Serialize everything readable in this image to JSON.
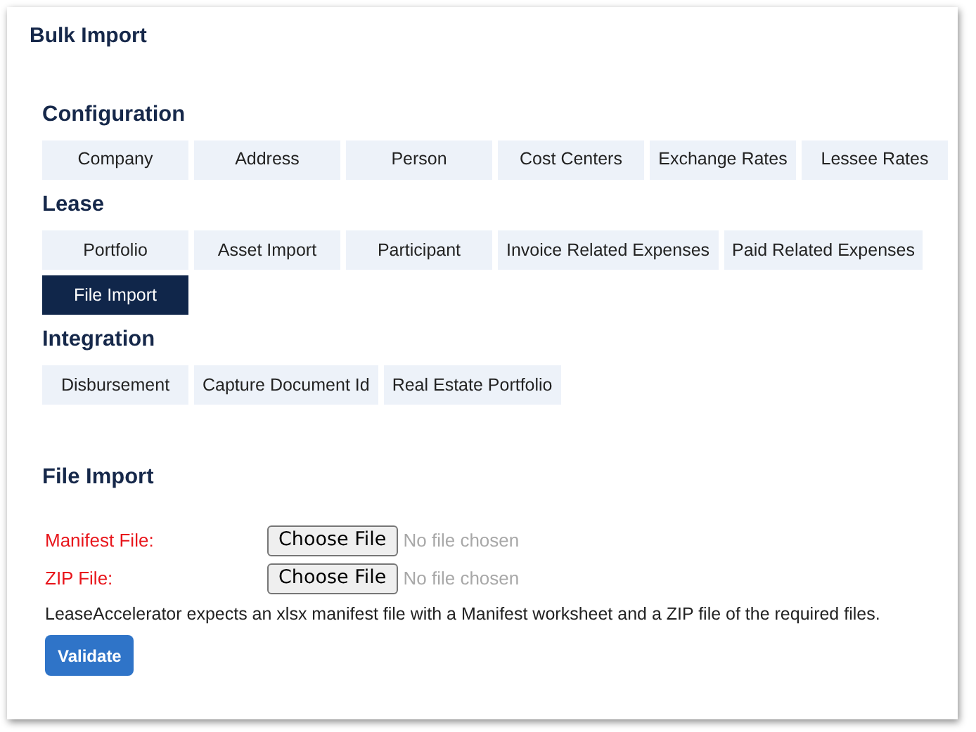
{
  "page": {
    "title": "Bulk Import"
  },
  "sections": [
    {
      "title": "Configuration",
      "tabs": [
        {
          "label": "Company",
          "selected": false
        },
        {
          "label": "Address",
          "selected": false
        },
        {
          "label": "Person",
          "selected": false
        },
        {
          "label": "Cost Centers",
          "selected": false
        },
        {
          "label": "Exchange Rates",
          "selected": false
        },
        {
          "label": "Lessee Rates",
          "selected": false
        }
      ]
    },
    {
      "title": "Lease",
      "tabs": [
        {
          "label": "Portfolio",
          "selected": false
        },
        {
          "label": "Asset Import",
          "selected": false
        },
        {
          "label": "Participant",
          "selected": false
        },
        {
          "label": "Invoice Related Expenses",
          "selected": false
        },
        {
          "label": "Paid Related Expenses",
          "selected": false
        },
        {
          "label": "File Import",
          "selected": true
        }
      ]
    },
    {
      "title": "Integration",
      "tabs": [
        {
          "label": "Disbursement",
          "selected": false
        },
        {
          "label": "Capture Document Id",
          "selected": false
        },
        {
          "label": "Real Estate Portfolio",
          "selected": false
        }
      ]
    }
  ],
  "form": {
    "title": "File Import",
    "fields": [
      {
        "label": "Manifest File:",
        "required": true,
        "button": "Choose File",
        "status": "No file chosen"
      },
      {
        "label": "ZIP File:",
        "required": true,
        "button": "Choose File",
        "status": "No file chosen"
      }
    ],
    "note": "LeaseAccelerator expects an xlsx manifest file with a Manifest worksheet and a ZIP file of the required files.",
    "submit": "Validate"
  }
}
